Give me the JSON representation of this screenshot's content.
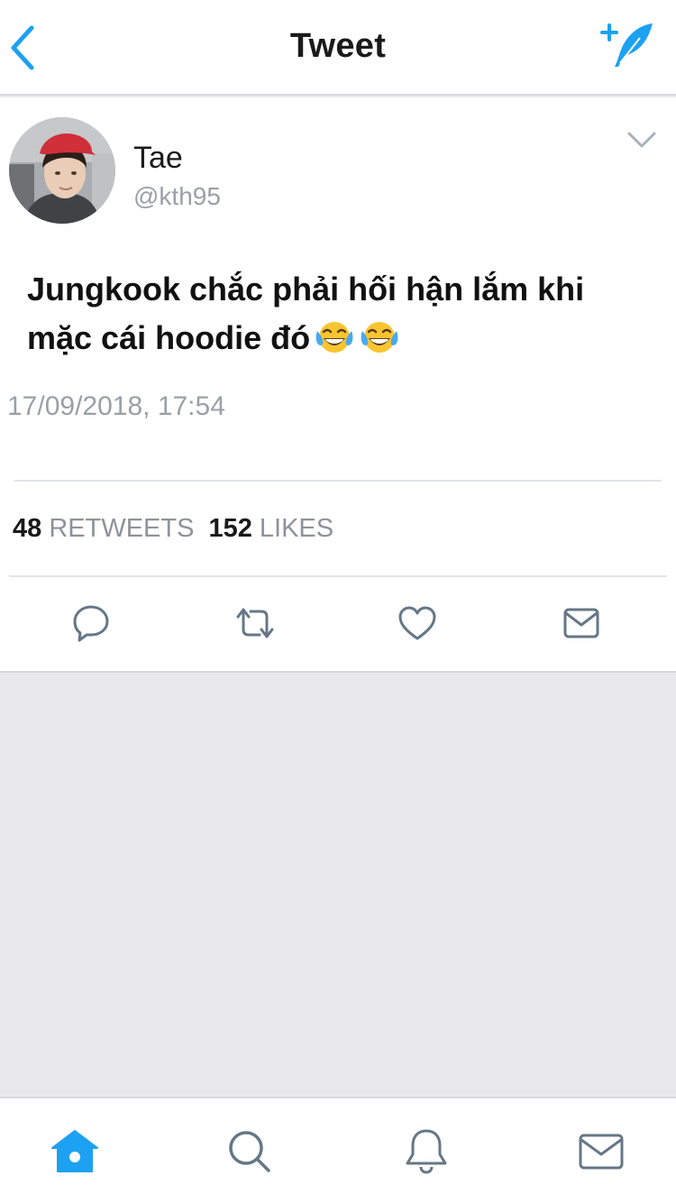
{
  "header": {
    "title": "Tweet"
  },
  "tweet": {
    "display_name": "Tae",
    "handle": "@kth95",
    "text_line1": "Jungkook chắc phải hối hận lắm khi",
    "text_line2": "mặc cái hoodie đó",
    "emojis": [
      "face-with-tears-of-joy",
      "face-with-tears-of-joy"
    ],
    "timestamp": "17/09/2018, 17:54",
    "retweets_count": "48",
    "retweets_label": "RETWEETS",
    "likes_count": "152",
    "likes_label": "LIKES"
  },
  "actions": [
    "reply-icon",
    "retweet-icon",
    "like-icon",
    "direct-message-icon"
  ],
  "tabbar": [
    "home-icon",
    "search-icon",
    "notifications-icon",
    "messages-icon"
  ],
  "colors": {
    "accent": "#1da1f2",
    "icon_gray": "#657786",
    "muted_text": "#9aa0a6",
    "background": "#e9e9ed"
  }
}
